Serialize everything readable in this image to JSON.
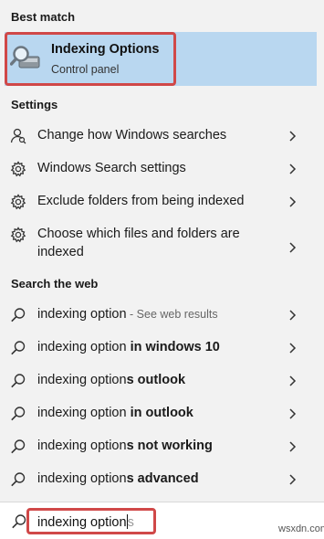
{
  "best_match": {
    "section_title": "Best match",
    "title": "Indexing Options",
    "subtitle": "Control panel",
    "icon": "indexing-options-icon"
  },
  "settings": {
    "section_title": "Settings",
    "items": [
      {
        "label": "Change how Windows searches",
        "icon": "person-search-icon"
      },
      {
        "label": "Windows Search settings",
        "icon": "gear-icon"
      },
      {
        "label": "Exclude folders from being indexed",
        "icon": "gear-icon"
      },
      {
        "label": "Choose which files and folders are indexed",
        "icon": "gear-icon"
      }
    ]
  },
  "web": {
    "section_title": "Search the web",
    "items": [
      {
        "prefix": "indexing option",
        "bold": "",
        "hint": " - See web results"
      },
      {
        "prefix": "indexing option ",
        "bold": "in windows 10",
        "hint": ""
      },
      {
        "prefix": "indexing option",
        "bold": "s outlook",
        "hint": ""
      },
      {
        "prefix": "indexing option ",
        "bold": "in outlook",
        "hint": ""
      },
      {
        "prefix": "indexing option",
        "bold": "s not working",
        "hint": ""
      },
      {
        "prefix": "indexing option",
        "bold": "s advanced",
        "hint": ""
      }
    ]
  },
  "search": {
    "typed": "indexing option",
    "completion": "s"
  },
  "watermark": "wsxdn.com",
  "colors": {
    "highlight": "#b9d7f0",
    "annotation_red": "#d04848",
    "background": "#f2f2f2"
  }
}
